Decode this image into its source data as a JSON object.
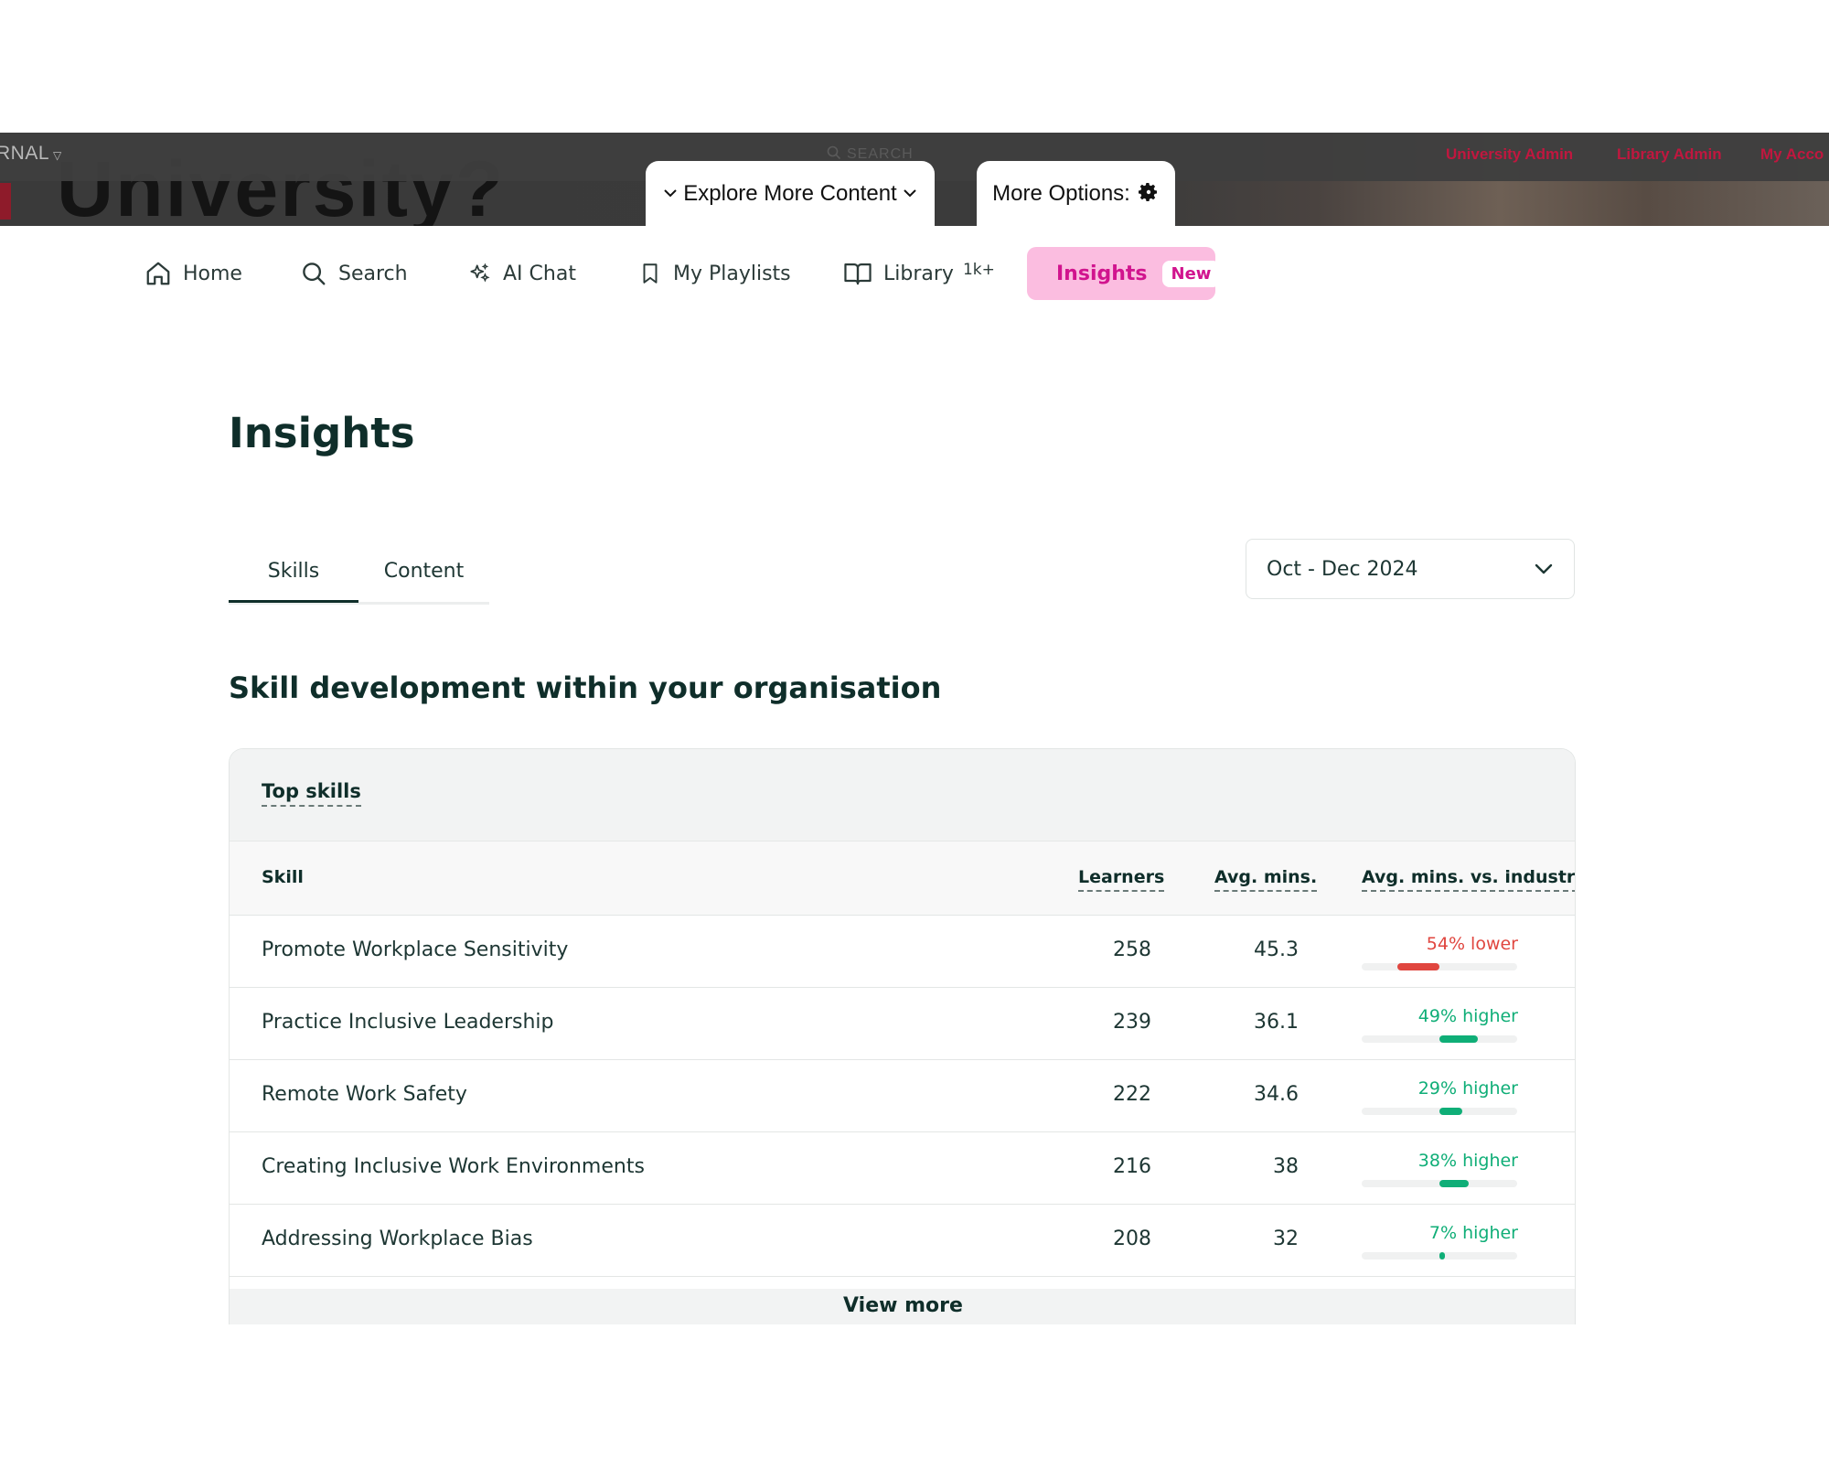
{
  "topbar": {
    "brand": "RNAL",
    "search_label": "SEARCH",
    "big_text": "University?",
    "links": [
      "University Admin",
      "Library Admin",
      "My Acco"
    ],
    "explore_label": "Explore More Content",
    "more_options_label": "More Options:"
  },
  "nav": {
    "items": [
      {
        "label": "Home",
        "icon": "home-icon"
      },
      {
        "label": "Search",
        "icon": "search-icon"
      },
      {
        "label": "AI Chat",
        "icon": "sparkle-icon"
      },
      {
        "label": "My Playlists",
        "icon": "bookmark-icon"
      },
      {
        "label": "Library",
        "icon": "book-icon",
        "badge": "1k+"
      },
      {
        "label": "Insights",
        "icon": "trending-up-icon",
        "badge": "New"
      }
    ]
  },
  "page": {
    "title": "Insights",
    "tabs": [
      {
        "label": "Skills",
        "active": true
      },
      {
        "label": "Content",
        "active": false
      }
    ],
    "date_range": "Oct - Dec 2024",
    "section_title": "Skill development within your organisation"
  },
  "table": {
    "card_title": "Top skills",
    "headers": {
      "skill": "Skill",
      "learners": "Learners",
      "avg_mins": "Avg. mins.",
      "vs_industry": "Avg. mins. vs. industry"
    },
    "rows": [
      {
        "skill": "Promote Workplace Sensitivity",
        "learners": "258",
        "avg_mins": "45.3",
        "comparison": "54% lower",
        "direction": "lower",
        "percent": 54
      },
      {
        "skill": "Practice Inclusive Leadership",
        "learners": "239",
        "avg_mins": "36.1",
        "comparison": "49% higher",
        "direction": "higher",
        "percent": 49
      },
      {
        "skill": "Remote Work Safety",
        "learners": "222",
        "avg_mins": "34.6",
        "comparison": "29% higher",
        "direction": "higher",
        "percent": 29
      },
      {
        "skill": "Creating Inclusive Work Environments",
        "learners": "216",
        "avg_mins": "38",
        "comparison": "38% higher",
        "direction": "higher",
        "percent": 38
      },
      {
        "skill": "Addressing Workplace Bias",
        "learners": "208",
        "avg_mins": "32",
        "comparison": "7% higher",
        "direction": "higher",
        "percent": 7
      }
    ],
    "view_more": "View more"
  },
  "colors": {
    "lower": "#e0463f",
    "higher": "#0fae77",
    "accent_pink": "#d1148e",
    "insights_bg": "#fbbde0",
    "admin_link": "#c0173f"
  }
}
